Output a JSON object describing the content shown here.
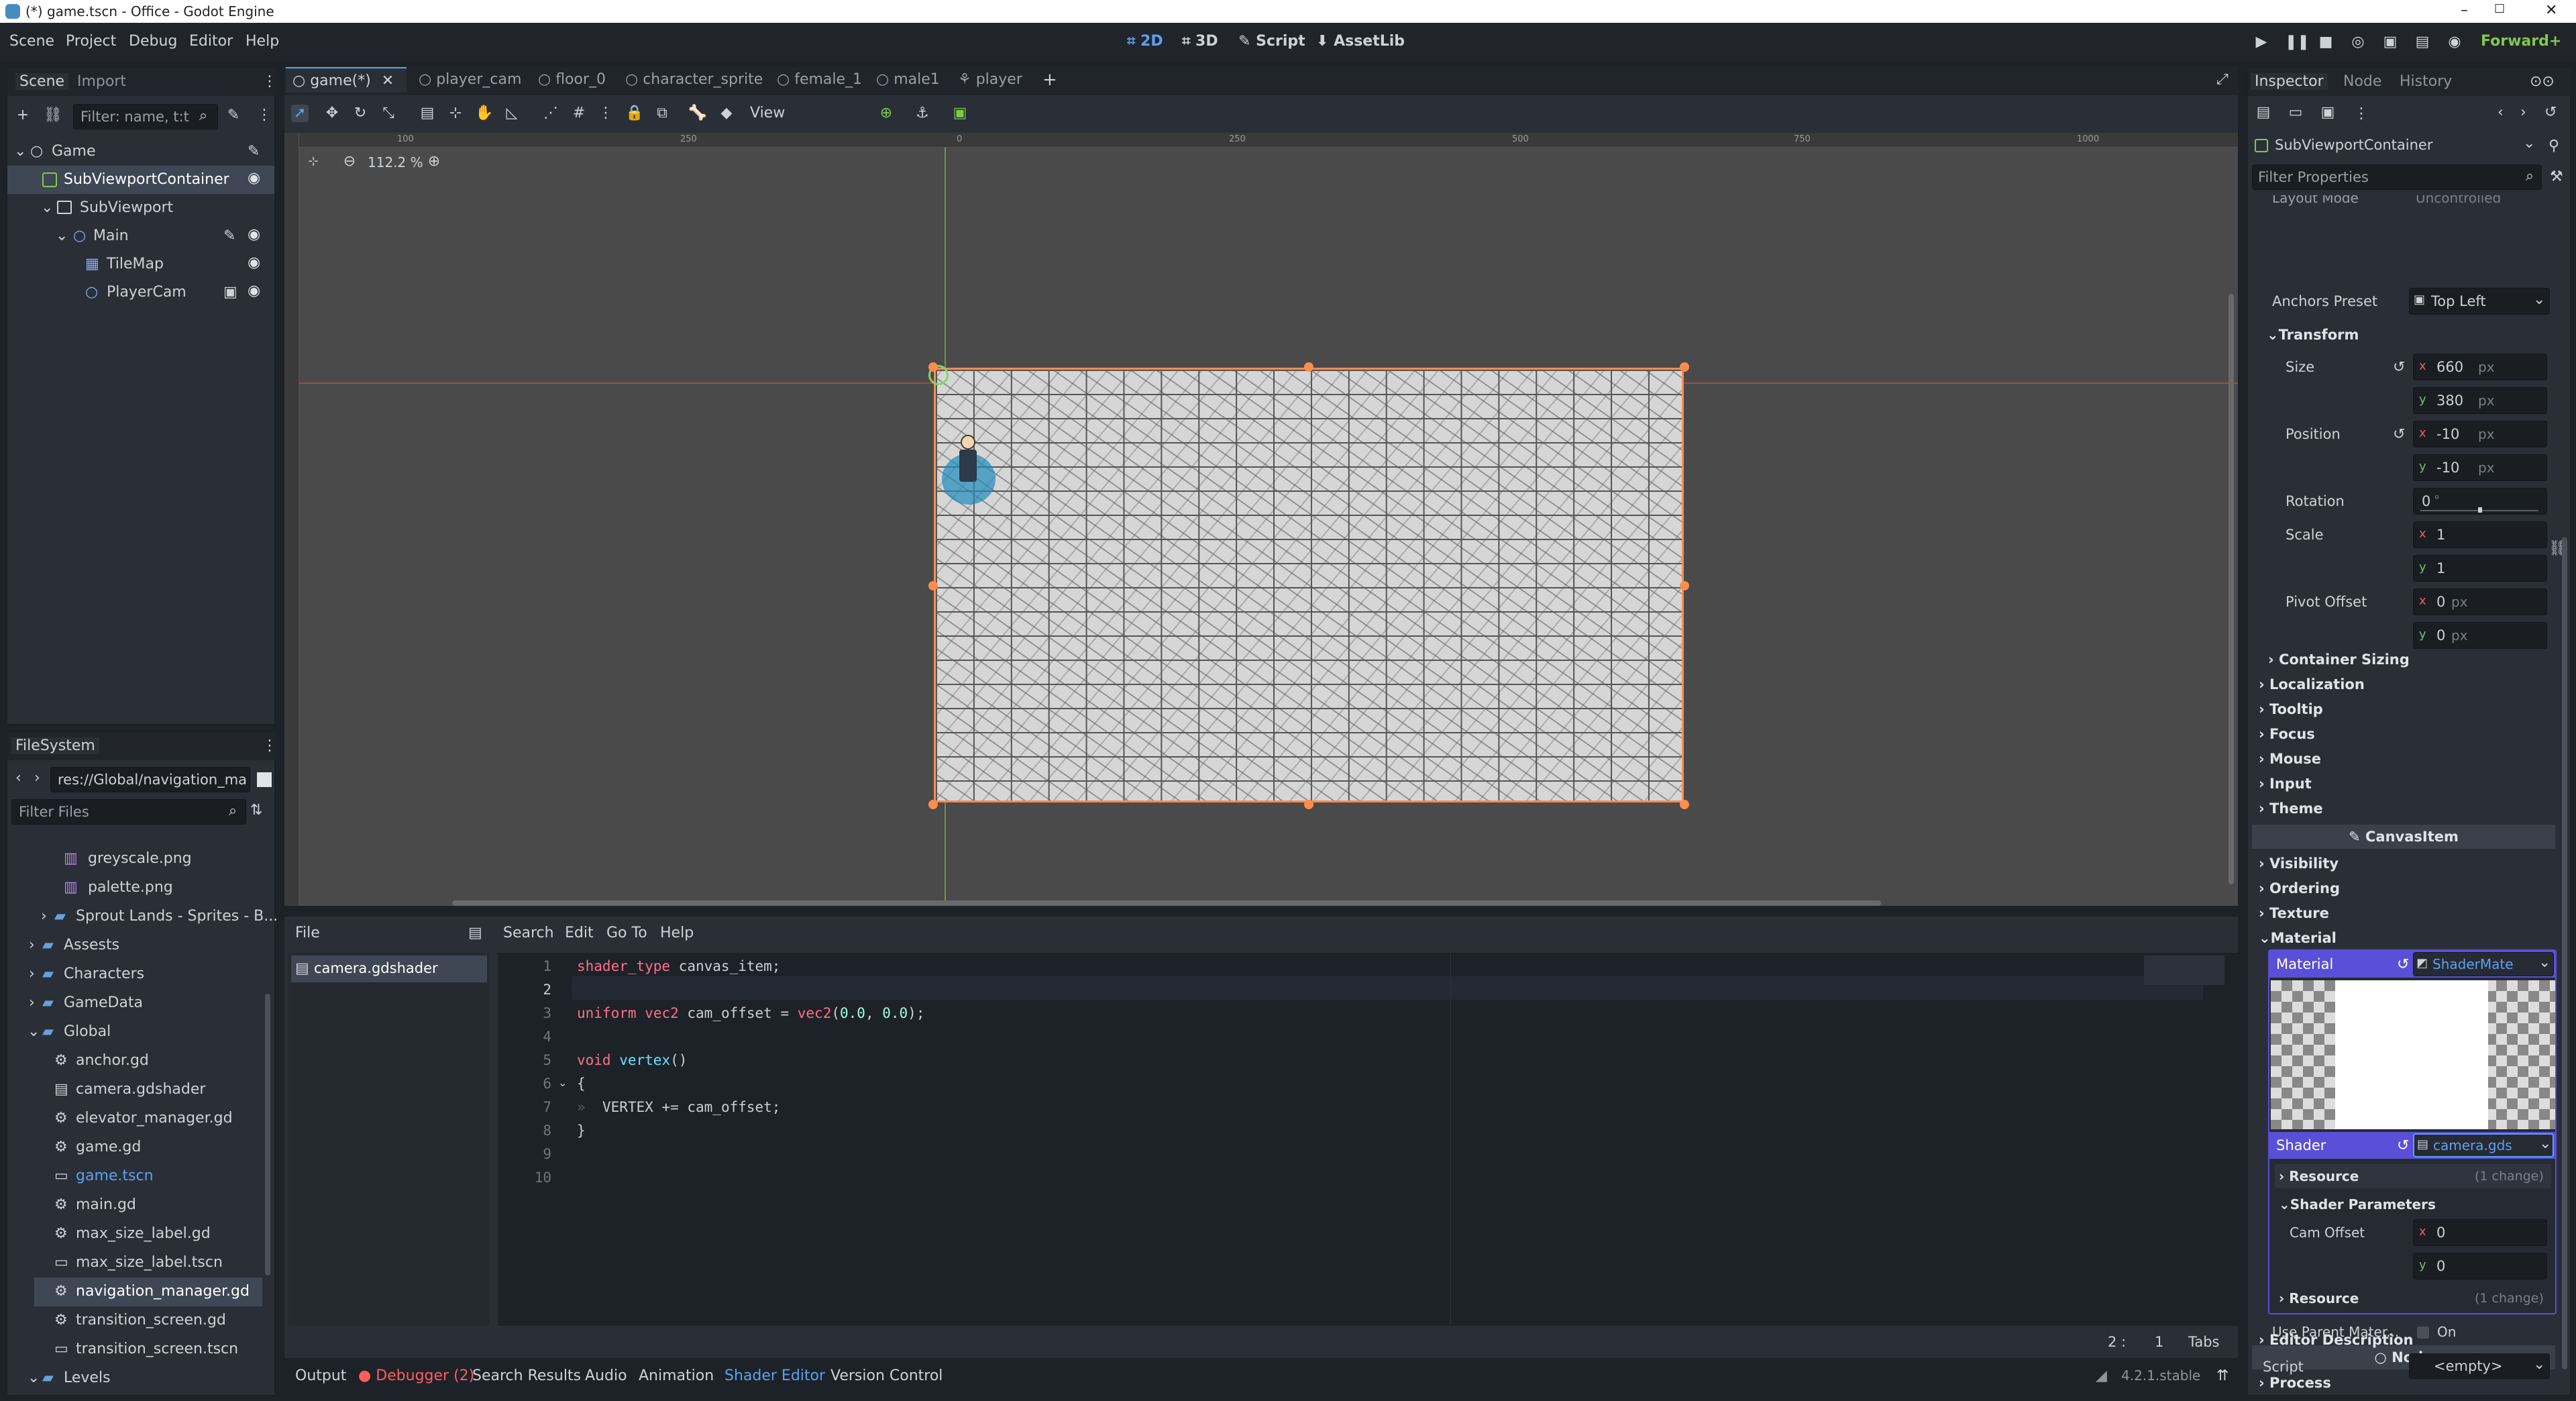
{
  "window": {
    "title": "(*) game.tscn - Office - Godot Engine",
    "controls": [
      "–",
      "☐",
      "✕"
    ]
  },
  "menu": [
    "Scene",
    "Project",
    "Debug",
    "Editor",
    "Help"
  ],
  "workspaces": [
    {
      "icon": "2D",
      "label": "2D"
    },
    {
      "icon": "3D",
      "label": "3D"
    },
    {
      "icon": "script",
      "label": "Script"
    },
    {
      "icon": "assetlib",
      "label": "AssetLib"
    }
  ],
  "renderer": "Forward+",
  "scene_dock": {
    "tabs": [
      "Scene",
      "Import"
    ],
    "filter_placeholder": "Filter: name, t:t",
    "tree": [
      {
        "label": "Game",
        "depth": 0
      },
      {
        "label": "SubViewportContainer",
        "depth": 1,
        "selected": true
      },
      {
        "label": "SubViewport",
        "depth": 1
      },
      {
        "label": "Main",
        "depth": 2
      },
      {
        "label": "TileMap",
        "depth": 3
      },
      {
        "label": "PlayerCam",
        "depth": 3
      }
    ]
  },
  "filesystem": {
    "title": "FileSystem",
    "path": "res://Global/navigation_ma",
    "filter_placeholder": "Filter Files",
    "items": [
      {
        "label": "greyscale.png",
        "kind": "image"
      },
      {
        "label": "palette.png",
        "kind": "image"
      },
      {
        "label": "Sprout Lands - Sprites - B...",
        "kind": "folder"
      },
      {
        "label": "Assests",
        "kind": "folder"
      },
      {
        "label": "Characters",
        "kind": "folder"
      },
      {
        "label": "GameData",
        "kind": "folder"
      },
      {
        "label": "Global",
        "kind": "folder"
      },
      {
        "label": "anchor.gd",
        "kind": "script"
      },
      {
        "label": "camera.gdshader",
        "kind": "shader"
      },
      {
        "label": "elevator_manager.gd",
        "kind": "script"
      },
      {
        "label": "game.gd",
        "kind": "script"
      },
      {
        "label": "game.tscn",
        "kind": "scene"
      },
      {
        "label": "main.gd",
        "kind": "script"
      },
      {
        "label": "max_size_label.gd",
        "kind": "script"
      },
      {
        "label": "max_size_label.tscn",
        "kind": "scene"
      },
      {
        "label": "navigation_manager.gd",
        "kind": "script",
        "selected": true
      },
      {
        "label": "transition_screen.gd",
        "kind": "script"
      },
      {
        "label": "transition_screen.tscn",
        "kind": "scene"
      },
      {
        "label": "Levels",
        "kind": "folder"
      }
    ]
  },
  "scene_tabs": [
    "game(*)",
    "player_cam",
    "floor_0",
    "character_sprite",
    "female_1",
    "male1",
    "player"
  ],
  "toolbar": {
    "view_label": "View"
  },
  "viewport": {
    "zoom": "112.2 %",
    "ruler_ticks": [
      "100",
      "250",
      "0",
      "250",
      "500",
      "750",
      "1000"
    ]
  },
  "shader_editor": {
    "menu": [
      "File",
      "Search",
      "Edit",
      "Go To",
      "Help"
    ],
    "file": "camera.gdshader",
    "line_numbers": [
      "1",
      "2",
      "3",
      "4",
      "5",
      "6",
      "7",
      "8",
      "9",
      "10"
    ],
    "status_line": "2 :",
    "status_col": "1",
    "indent_mode": "Tabs"
  },
  "bottom_tabs": [
    "Output",
    "Debugger (2)",
    "Search Results",
    "Audio",
    "Animation",
    "Shader Editor",
    "Version Control"
  ],
  "version": "4.2.1.stable",
  "inspector": {
    "tabs": [
      "Inspector",
      "Node",
      "History"
    ],
    "node_name": "SubViewportContainer",
    "filter_placeholder": "Filter Properties",
    "layout_mode_label": "Layout Mode",
    "layout_mode_value": "Uncontrolled",
    "anchors_preset_label": "Anchors Preset",
    "anchors_preset_value": "Top Left",
    "transform_label": "Transform",
    "size_label": "Size",
    "size_x": "660",
    "size_y": "380",
    "unit_px": "px",
    "position_label": "Position",
    "position_x": "-10",
    "position_y": "-10",
    "rotation_label": "Rotation",
    "rotation_value": "0",
    "rotation_unit": "°",
    "scale_label": "Scale",
    "scale_x": "1",
    "scale_y": "1",
    "pivot_label": "Pivot Offset",
    "pivot_x": "0",
    "pivot_y": "0",
    "sections": [
      "Container Sizing",
      "Localization",
      "Tooltip",
      "Focus",
      "Mouse",
      "Input",
      "Theme"
    ],
    "canvasitem_label": "CanvasItem",
    "ci_sections": [
      "Visibility",
      "Ordering",
      "Texture",
      "Material"
    ],
    "material_label": "Material",
    "material_value": "ShaderMate",
    "shader_label": "Shader",
    "shader_value": "camera.gds",
    "resource_label": "Resource",
    "resource_change": "(1 change)",
    "shader_params_label": "Shader Parameters",
    "cam_offset_label": "Cam Offset",
    "cam_x": "0",
    "cam_y": "0",
    "use_parent_label": "Use Parent Mater...",
    "use_parent_value": "On",
    "node_label": "Node",
    "process_label": "Process",
    "editor_desc_label": "Editor Description",
    "script_label": "Script",
    "script_value": "<empty>",
    "axis_x": "x",
    "axis_y": "y"
  },
  "colors": {
    "accent": "#5ea0f0",
    "material_header": "#5a4fd8",
    "selection_outline": "#ff8c4c",
    "error": "#ff5d5d"
  }
}
